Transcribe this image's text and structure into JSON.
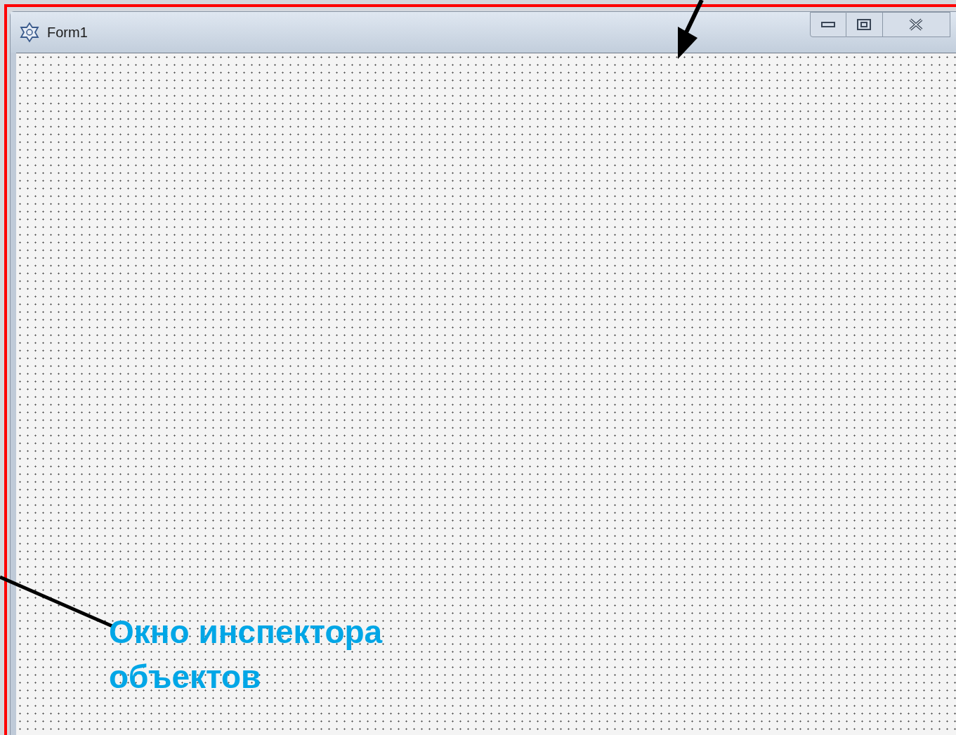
{
  "window": {
    "title": "Form1"
  },
  "annotation": {
    "text": "Окно инспектора объектов"
  }
}
